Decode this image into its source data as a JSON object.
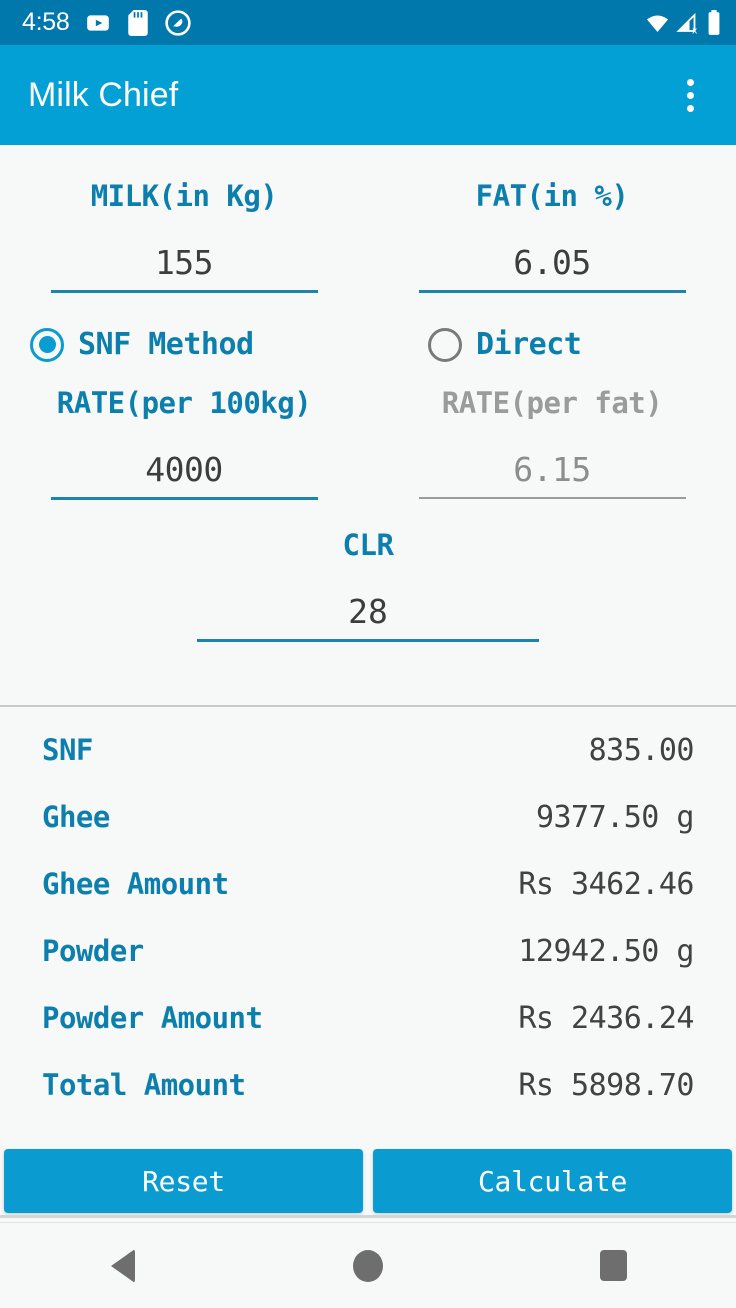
{
  "status_bar": {
    "time": "4:58",
    "left_icons": [
      "youtube-play-icon",
      "sd-card-icon",
      "do-not-disturb-icon"
    ],
    "right_icons": [
      "wifi-icon",
      "cellular-no-sim-icon",
      "battery-full-icon"
    ],
    "background_color": "#0178ab"
  },
  "app_bar": {
    "title": "Milk Chief",
    "overflow_icon": "overflow-menu-icon",
    "background_color": "#03a0d5"
  },
  "form": {
    "milk": {
      "label": "MILK(in Kg)",
      "value": "155",
      "enabled": true
    },
    "fat": {
      "label": "FAT(in %)",
      "value": "6.05",
      "enabled": true
    },
    "method": {
      "snf": {
        "label": "SNF Method",
        "selected": true
      },
      "direct": {
        "label": "Direct",
        "selected": false
      }
    },
    "rate_per_100kg": {
      "label": "RATE(per 100kg)",
      "value": "4000",
      "enabled": true
    },
    "rate_per_fat": {
      "label": "RATE(per fat)",
      "value": "6.15",
      "enabled": false
    },
    "clr": {
      "label": "CLR",
      "value": "28",
      "enabled": true
    }
  },
  "results": [
    {
      "label": "SNF",
      "value": "835.00"
    },
    {
      "label": "Ghee",
      "value": "9377.50 g"
    },
    {
      "label": "Ghee Amount",
      "value": "Rs 3462.46"
    },
    {
      "label": "Powder",
      "value": "12942.50 g"
    },
    {
      "label": "Powder Amount",
      "value": "Rs 2436.24"
    },
    {
      "label": "Total Amount",
      "value": "Rs 5898.70"
    }
  ],
  "buttons": {
    "reset": "Reset",
    "calculate": "Calculate"
  },
  "nav_bar": {
    "back": "back-icon",
    "home": "home-icon",
    "recents": "recents-icon"
  },
  "colors": {
    "accent": "#0a9bd1",
    "label_blue": "#0d7fac",
    "status_bar": "#0178ab",
    "disabled_gray": "#9b9b9b",
    "value_gray": "#424242"
  }
}
